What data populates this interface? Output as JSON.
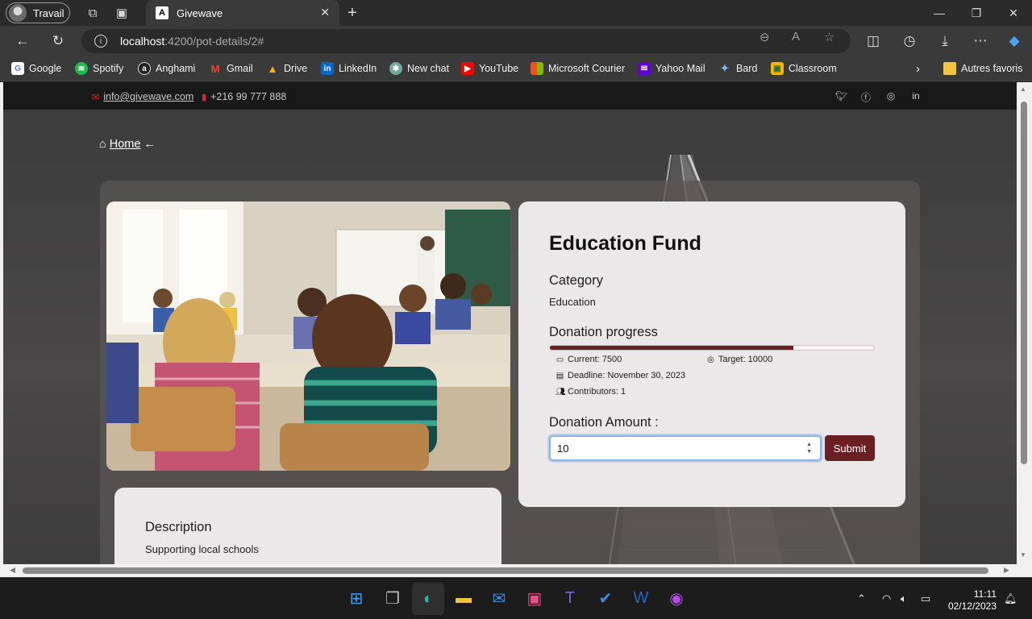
{
  "browser": {
    "profile_label": "Travail",
    "tab_title": "Givewave",
    "url_host": "localhost",
    "url_path": ":4200/pot-details/2#",
    "bookmarks": [
      {
        "label": "Google",
        "color": "#ffffff"
      },
      {
        "label": "Spotify",
        "color": "#1db954"
      },
      {
        "label": "Anghami",
        "color": "#222222"
      },
      {
        "label": "Gmail",
        "color": "#ea4335"
      },
      {
        "label": "Drive",
        "color": "#fbbc04"
      },
      {
        "label": "LinkedIn",
        "color": "#0a66c2"
      },
      {
        "label": "New chat",
        "color": "#74aa9c"
      },
      {
        "label": "YouTube",
        "color": "#ff0000"
      },
      {
        "label": "Microsoft Courier",
        "color": "#f25022"
      },
      {
        "label": "Yahoo Mail",
        "color": "#6001d2"
      },
      {
        "label": "Bard",
        "color": "#8ab4f8"
      },
      {
        "label": "Classroom",
        "color": "#f4b400"
      }
    ],
    "other_favorites": "Autres favoris"
  },
  "site": {
    "email": "info@givewave.com",
    "phone": "+216 99 777 888",
    "socials": [
      "twitter-icon",
      "facebook-icon",
      "instagram-icon",
      "linkedin-icon"
    ],
    "breadcrumb_home": "Home",
    "breadcrumb_arrow": "←"
  },
  "pot": {
    "title": "Education Fund",
    "category_label": "Category",
    "category_value": "Education",
    "progress_label": "Donation progress",
    "progress_fraction": 0.75,
    "current": "Current: 7500",
    "target": "Target: 10000",
    "deadline": "Deadline: November 30, 2023",
    "contributors": "Contributors: 1",
    "amount_label": "Donation Amount :",
    "amount_value": "10",
    "submit_label": "Submit",
    "description_label": "Description",
    "description_value": "Supporting local schools"
  },
  "taskbar": {
    "time": "11:11",
    "date": "02/12/2023"
  },
  "colors": {
    "accent": "#6b1f22",
    "card_bg": "#ebe8e9"
  }
}
